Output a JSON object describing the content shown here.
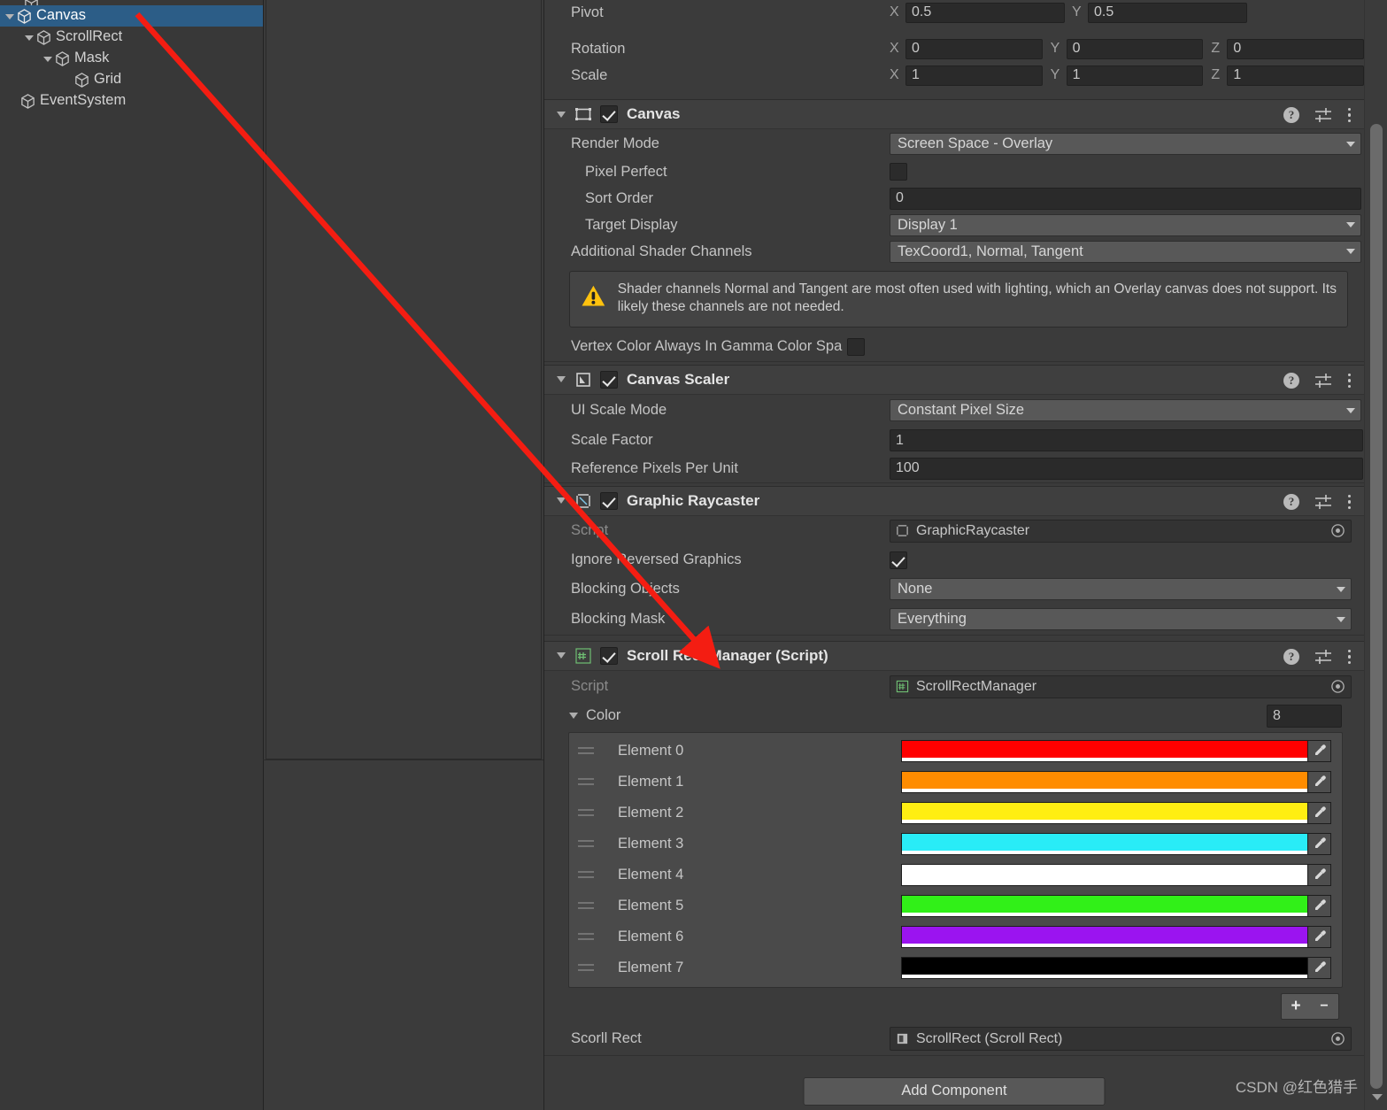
{
  "app": "Unity Editor Inspector",
  "hierarchy": {
    "name": "hierarchy-panel",
    "items": [
      {
        "label": "Canvas",
        "depth": 0,
        "selected": true,
        "expanded": true,
        "icon": "gameobject-cube-icon"
      },
      {
        "label": "ScrollRect",
        "depth": 1,
        "selected": false,
        "expanded": true,
        "icon": "gameobject-cube-icon"
      },
      {
        "label": "Mask",
        "depth": 2,
        "selected": false,
        "expanded": true,
        "icon": "gameobject-cube-icon"
      },
      {
        "label": "Grid",
        "depth": 3,
        "selected": false,
        "expanded": false,
        "icon": "gameobject-cube-icon"
      },
      {
        "label": "EventSystem",
        "depth": 1,
        "selected": false,
        "expanded": false,
        "icon": "gameobject-cube-icon"
      }
    ]
  },
  "transform": {
    "pivot": {
      "label": "Pivot",
      "x_axis": "X",
      "x": "0.5",
      "y_axis": "Y",
      "y": "0.5"
    },
    "rotation": {
      "label": "Rotation",
      "x_axis": "X",
      "x": "0",
      "y_axis": "Y",
      "y": "0",
      "z_axis": "Z",
      "z": "0"
    },
    "scale": {
      "label": "Scale",
      "x_axis": "X",
      "x": "1",
      "y_axis": "Y",
      "y": "1",
      "z_axis": "Z",
      "z": "1"
    }
  },
  "canvas": {
    "title": "Canvas",
    "enabled": true,
    "render_mode": {
      "label": "Render Mode",
      "value": "Screen Space - Overlay"
    },
    "pixel_perfect": {
      "label": "Pixel Perfect",
      "checked": false
    },
    "sort_order": {
      "label": "Sort Order",
      "value": "0"
    },
    "target_display": {
      "label": "Target Display",
      "value": "Display 1"
    },
    "additional_shader_channels": {
      "label": "Additional Shader Channels",
      "value": "TexCoord1, Normal, Tangent"
    },
    "warning": "Shader channels Normal and Tangent are most often used with lighting, which an Overlay canvas does not support. Its likely these channels are not needed.",
    "vertex_color_gamma": {
      "label": "Vertex Color Always In Gamma Color Spa",
      "checked": false
    }
  },
  "canvas_scaler": {
    "title": "Canvas Scaler",
    "enabled": true,
    "ui_scale_mode": {
      "label": "UI Scale Mode",
      "value": "Constant Pixel Size"
    },
    "scale_factor": {
      "label": "Scale Factor",
      "value": "1"
    },
    "reference_pixels_per_unit": {
      "label": "Reference Pixels Per Unit",
      "value": "100"
    }
  },
  "graphic_raycaster": {
    "title": "Graphic Raycaster",
    "enabled": true,
    "script": {
      "label": "Script",
      "value": "GraphicRaycaster"
    },
    "ignore_reversed_graphics": {
      "label": "Ignore Reversed Graphics",
      "checked": true
    },
    "blocking_objects": {
      "label": "Blocking Objects",
      "value": "None"
    },
    "blocking_mask": {
      "label": "Blocking Mask",
      "value": "Everything"
    }
  },
  "scroll_rect_manager": {
    "title": "Scroll Rect Manager (Script)",
    "enabled": true,
    "script": {
      "label": "Script",
      "value": "ScrollRectManager"
    },
    "color_array": {
      "label": "Color",
      "size": "8",
      "elements": [
        {
          "label": "Element 0",
          "color": "#ff0000"
        },
        {
          "label": "Element 1",
          "color": "#ff8c00"
        },
        {
          "label": "Element 2",
          "color": "#ffee12"
        },
        {
          "label": "Element 3",
          "color": "#29ecf7"
        },
        {
          "label": "Element 4",
          "color": "#ffffff"
        },
        {
          "label": "Element 5",
          "color": "#31f018"
        },
        {
          "label": "Element 6",
          "color": "#9b14f0"
        },
        {
          "label": "Element 7",
          "color": "#000000"
        }
      ],
      "add_label": "+",
      "remove_label": "−"
    },
    "scroll_rect_field": {
      "label": "Scorll Rect",
      "value": "ScrollRect (Scroll Rect)"
    }
  },
  "footer": {
    "add_component": "Add Component"
  },
  "watermark": "CSDN @红色猎手",
  "annotation": {
    "arrow_color": "#f41d12"
  },
  "theme": {
    "panel_bg": "#3b3b3b",
    "header_bg": "#3f3f3f",
    "selection_blue": "#2c5d87",
    "field_bg": "#2a2a2a",
    "dropdown_bg": "#585858",
    "warning_yellow": "#ffc20e"
  }
}
